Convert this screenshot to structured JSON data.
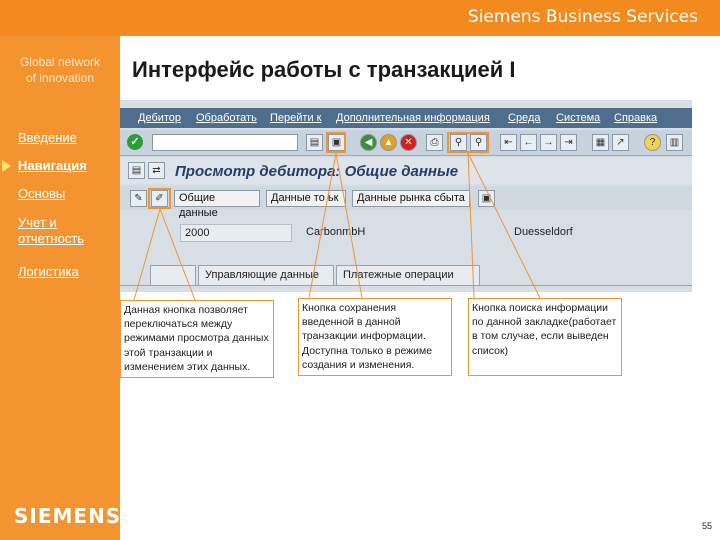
{
  "header": {
    "company": "Siemens Business Services"
  },
  "sidebar": {
    "tagline_line1": "Global network",
    "tagline_line2": "of innovation",
    "items": [
      {
        "label": "Введение"
      },
      {
        "label": "Навигация"
      },
      {
        "label": "Основы"
      },
      {
        "label": "Учет и отчетность"
      },
      {
        "label": "Логистика"
      }
    ],
    "logo": "SIEMENS"
  },
  "page_title": "Интерфейс работы с транзакцией I",
  "sap": {
    "menu": [
      "Дебитор",
      "Обработать",
      "Перейти к",
      "Дополнительная информация",
      "Среда",
      "Система",
      "Справка"
    ],
    "screen_title": "Просмотр дебитора: Общие данные",
    "app_buttons": [
      "Общие данные",
      "Данные то ьк",
      "Данные рынка сбыта"
    ],
    "fields": {
      "code": "2000",
      "name": "CarbonmbH",
      "city": "Duesseldorf"
    },
    "tabs": [
      "Управляющие данные",
      "Платежные операции"
    ],
    "icons": {
      "enter": "check-icon",
      "save": "save-icon",
      "back": "back-icon",
      "exit": "exit-icon",
      "cancel": "cancel-icon",
      "print": "print-icon",
      "find": "find-icon",
      "help": "help-icon"
    }
  },
  "callouts": {
    "edit_toggle": "Данная кнопка позволяет переключаться между режимами просмотра данных этой транзакции и изменением этих данных.",
    "save": "Кнопка сохранения введенной в данной транзакции информации. Доступна только в режиме создания и изменения.",
    "find": "Кнопка поиска информации по данной закладке(работает в том случае, если выведен список)"
  },
  "colors": {
    "accent": "#f39431",
    "banner": "#f28a1e",
    "sap_menu": "#4f6e8e"
  },
  "slide_number": "55"
}
